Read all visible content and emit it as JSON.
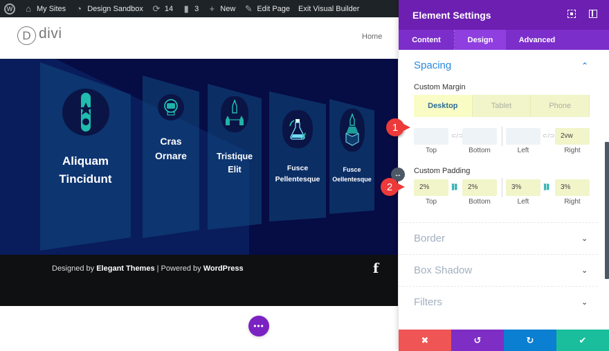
{
  "admin_bar": {
    "wp_logo": "W",
    "items": [
      {
        "icon": "network-icon",
        "glyph": "⌂",
        "label": "My Sites"
      },
      {
        "icon": "dashboard-icon",
        "glyph": "◔",
        "label": "Design Sandbox"
      },
      {
        "icon": "updates-icon",
        "glyph": "⟳",
        "label": "14"
      },
      {
        "icon": "comments-icon",
        "glyph": "▮",
        "label": "3"
      },
      {
        "icon": "plus-icon",
        "glyph": "+",
        "label": "New"
      },
      {
        "icon": "pencil-icon",
        "glyph": "✎",
        "label": "Edit Page"
      },
      {
        "icon": "",
        "glyph": "",
        "label": "Exit Visual Builder"
      }
    ]
  },
  "site_header": {
    "logo_letter": "D",
    "logo_text": "divi",
    "nav": [
      "Home"
    ]
  },
  "hero": {
    "cards": [
      {
        "title_line1": "Aliquam",
        "title_line2": "Tincidunt",
        "icon": "rocket-badge-icon"
      },
      {
        "title_line1": "Cras",
        "title_line2": "Ornare",
        "icon": "astronaut-helmet-icon"
      },
      {
        "title_line1": "Tristique",
        "title_line2": "Elit",
        "icon": "rockets-network-icon"
      },
      {
        "title_line1": "Fusce",
        "title_line2": "Pellentesque",
        "icon": "flask-icon"
      },
      {
        "title_line1": "Fusce",
        "title_line2": "Oellentesque",
        "icon": "rocket-cube-icon"
      }
    ]
  },
  "footer": {
    "designed_by": "Designed by ",
    "designer": "Elegant Themes",
    "separator": " | Powered by ",
    "platform": "WordPress",
    "social_icon": "f"
  },
  "fab": {
    "glyph": "•••"
  },
  "panel": {
    "title": "Element Settings",
    "tabs": [
      {
        "label": "Content",
        "active": false
      },
      {
        "label": "Design",
        "active": true
      },
      {
        "label": "Advanced",
        "active": false
      }
    ],
    "spacing": {
      "title": "Spacing",
      "margin": {
        "label": "Custom Margin",
        "devices": [
          {
            "label": "Desktop",
            "active": true
          },
          {
            "label": "Tablet",
            "active": false
          },
          {
            "label": "Phone",
            "active": false
          }
        ],
        "fields": [
          {
            "label": "Top",
            "value": ""
          },
          {
            "label": "Bottom",
            "value": ""
          },
          {
            "label": "Left",
            "value": ""
          },
          {
            "label": "Right",
            "value": "2vw"
          }
        ],
        "link_glyph": "⊂/⊃"
      },
      "padding": {
        "label": "Custom Padding",
        "fields": [
          {
            "label": "Top",
            "value": "2%"
          },
          {
            "label": "Bottom",
            "value": "2%"
          },
          {
            "label": "Left",
            "value": "3%"
          },
          {
            "label": "Right",
            "value": "3%"
          }
        ],
        "link_glyph": "⛓"
      }
    },
    "sections": [
      "Border",
      "Box Shadow",
      "Filters"
    ],
    "actions": {
      "cancel": "✖",
      "undo": "↺",
      "redo": "↻",
      "save": "✔"
    }
  },
  "callouts": [
    "1",
    "2"
  ],
  "colors": {
    "panel_header": "#6c1fb0",
    "panel_tabs": "#7c2ecb",
    "accent_blue": "#2b87da",
    "cancel": "#ef5555",
    "undo": "#7e2ec4",
    "redo": "#0b7fd1",
    "save": "#1abe9c",
    "callout": "#ec3a3a"
  }
}
